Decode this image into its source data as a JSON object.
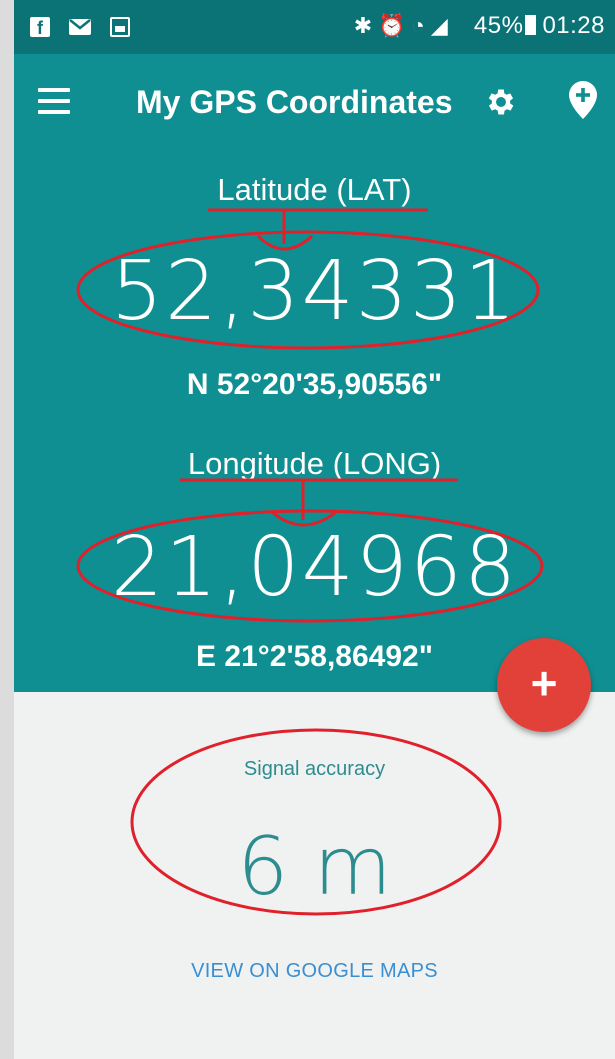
{
  "status_bar": {
    "icons_left": [
      "facebook-icon",
      "mail-icon",
      "image-icon"
    ],
    "icons_right": [
      "bluetooth-icon",
      "alarm-icon",
      "wifi-icon",
      "signal-icon",
      "battery-icon"
    ],
    "battery": "45%",
    "time": "01:28"
  },
  "app_bar": {
    "title": "My GPS Coordinates",
    "menu_icon": "menu-icon",
    "settings_icon": "gear-icon",
    "location_icon": "add-location-icon"
  },
  "latitude": {
    "label": "Latitude (LAT)",
    "value": "52,34331",
    "dms": "N 52°20'35,90556\""
  },
  "longitude": {
    "label": "Longitude (LONG)",
    "value": "21,04968",
    "dms": "E 21°2'58,86492\""
  },
  "fab": {
    "label": "+"
  },
  "accuracy": {
    "label": "Signal accuracy",
    "value": "6 m"
  },
  "link": {
    "label": "VIEW ON GOOGLE MAPS"
  },
  "colors": {
    "primary": "#0f8f91",
    "status_bar": "#0b7376",
    "accent": "#e2413a",
    "link": "#3a8fd1",
    "annotation": "#e0202a"
  }
}
